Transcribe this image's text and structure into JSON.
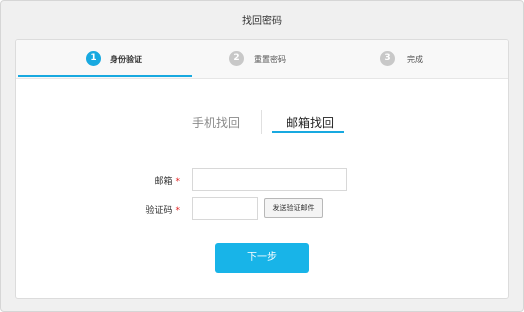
{
  "window": {
    "title": "找回密码"
  },
  "steps": [
    {
      "number": "1",
      "label": "身份验证",
      "state": "active"
    },
    {
      "number": "2",
      "label": "重置密码",
      "state": "inactive"
    },
    {
      "number": "3",
      "label": "完成",
      "state": "inactive"
    }
  ],
  "tabs": {
    "phone": "手机找回",
    "email": "邮箱找回",
    "selected": "email"
  },
  "form": {
    "email_label": "邮箱",
    "email_required": "*",
    "email_value": "",
    "code_label": "验证码",
    "code_required": "*",
    "code_value": "",
    "send_button": "发送验证邮件"
  },
  "next_button": "下一步",
  "colors": {
    "accent": "#18a9e0",
    "required": "#e02020",
    "inactive_step": "#c8c8c8"
  }
}
